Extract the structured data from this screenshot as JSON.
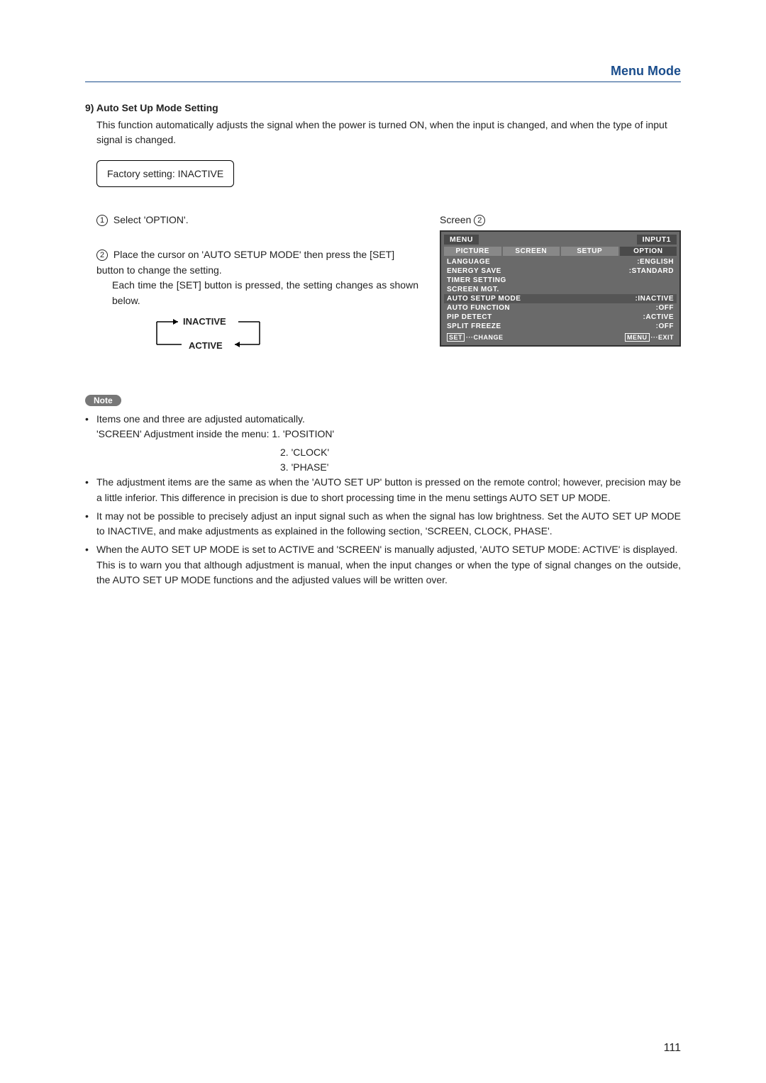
{
  "header": {
    "title": "Menu Mode"
  },
  "section": {
    "number": "9)",
    "title": "Auto Set Up Mode Setting",
    "intro": "This function automatically adjusts the signal when the power is turned ON, when the input is changed, and when the type of input signal is changed.",
    "factory": "Factory setting: INACTIVE"
  },
  "steps": {
    "s1": {
      "num": "1",
      "text": "Select 'OPTION'."
    },
    "s2": {
      "num": "2",
      "line1": "Place the cursor on 'AUTO SETUP MODE' then press the [SET] button to change the setting.",
      "line2": "Each time the [SET] button is pressed, the setting changes as shown below."
    },
    "cycle": {
      "a": "INACTIVE",
      "b": "ACTIVE"
    }
  },
  "screen": {
    "label_prefix": "Screen",
    "label_num": "2",
    "menu": "MENU",
    "input": "INPUT1",
    "tabs": [
      "PICTURE",
      "SCREEN",
      "SETUP",
      "OPTION"
    ],
    "rows": [
      {
        "label": "LANGUAGE",
        "value": ":ENGLISH"
      },
      {
        "label": "ENERGY SAVE",
        "value": ":STANDARD"
      },
      {
        "label": "TIMER SETTING",
        "value": ""
      },
      {
        "label": "SCREEN MGT.",
        "value": ""
      },
      {
        "label": "AUTO SETUP MODE",
        "value": ":INACTIVE",
        "hl": true
      },
      {
        "label": "AUTO FUNCTION",
        "value": ":OFF"
      },
      {
        "label": "PIP DETECT",
        "value": ":ACTIVE"
      },
      {
        "label": "SPLIT FREEZE",
        "value": ":OFF"
      }
    ],
    "footer": {
      "set": "SET",
      "change": "···CHANGE",
      "menu": "MENU",
      "exit": "···EXIT"
    }
  },
  "note": {
    "badge": "Note",
    "items": {
      "n1a": "Items one and three are adjusted automatically.",
      "n1b": "'SCREEN' Adjustment inside the menu:  1. 'POSITION'",
      "adj2": "2. 'CLOCK'",
      "adj3": "3. 'PHASE'",
      "n2": "The adjustment items are the same as when the 'AUTO SET UP' button is pressed on the remote control; however, precision may be a little inferior. This difference in precision is due to short processing time in the menu settings AUTO SET UP MODE.",
      "n3": "It may not be possible to precisely adjust an input signal such as when the signal has low brightness. Set the AUTO SET UP MODE to INACTIVE, and make adjustments as explained in the following section, 'SCREEN, CLOCK, PHASE'.",
      "n4a": "When the AUTO SET UP MODE is set to ACTIVE and 'SCREEN' is manually adjusted, 'AUTO SETUP MODE: ACTIVE' is displayed.",
      "n4b": "This is to warn you that although adjustment is manual, when the input changes or when the type of signal changes on the outside, the AUTO SET UP MODE functions and the adjusted values will be written over."
    }
  },
  "page": "111"
}
